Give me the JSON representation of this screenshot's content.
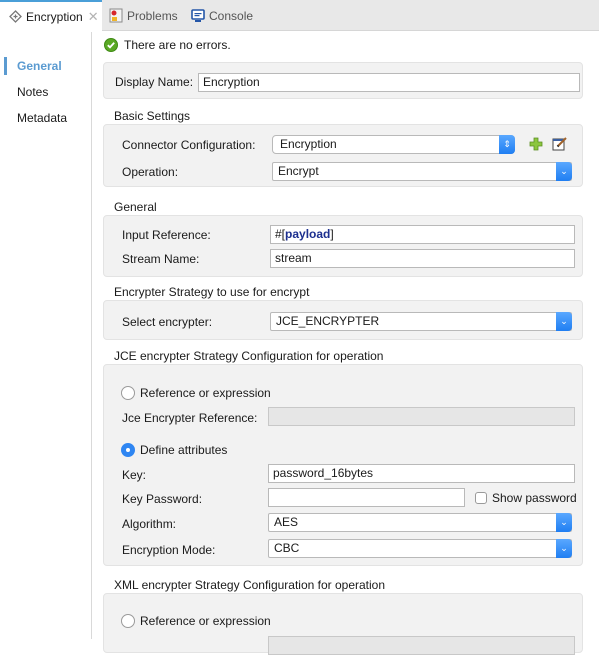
{
  "tabs": [
    {
      "label": "Encryption",
      "icon": "connector-icon",
      "active": true,
      "closable": true
    },
    {
      "label": "Problems",
      "icon": "problems-icon",
      "active": false
    },
    {
      "label": "Console",
      "icon": "console-icon",
      "active": false
    }
  ],
  "sidebar": {
    "items": [
      {
        "label": "General",
        "active": true
      },
      {
        "label": "Notes",
        "active": false
      },
      {
        "label": "Metadata",
        "active": false
      }
    ]
  },
  "status": {
    "text": "There are no errors.",
    "icon": "check-circle-icon"
  },
  "display_name": {
    "label": "Display Name:",
    "value": "Encryption"
  },
  "basic_settings": {
    "title": "Basic Settings",
    "connector_config": {
      "label": "Connector Configuration:",
      "value": "Encryption"
    },
    "operation": {
      "label": "Operation:",
      "value": "Encrypt"
    }
  },
  "general": {
    "title": "General",
    "input_reference": {
      "label": "Input Reference:",
      "prefix": "#[",
      "expr": "payload",
      "suffix": "]"
    },
    "stream_name": {
      "label": "Stream Name:",
      "value": "stream"
    }
  },
  "encrypter_strategy": {
    "title": "Encrypter Strategy to use for encrypt",
    "select": {
      "label": "Select encrypter:",
      "value": "JCE_ENCRYPTER"
    }
  },
  "jce_config": {
    "title": "JCE encrypter Strategy Configuration for operation",
    "ref_radio": {
      "label": "Reference or expression",
      "checked": false
    },
    "ref_field": {
      "label": "Jce Encrypter Reference:",
      "value": ""
    },
    "define_radio": {
      "label": "Define attributes",
      "checked": true
    },
    "key": {
      "label": "Key:",
      "value": "password_16bytes"
    },
    "key_password": {
      "label": "Key Password:",
      "value": ""
    },
    "show_password": {
      "label": "Show password",
      "checked": false
    },
    "algorithm": {
      "label": "Algorithm:",
      "value": "AES"
    },
    "mode": {
      "label": "Encryption Mode:",
      "value": "CBC"
    }
  },
  "xml_config": {
    "title": "XML encrypter Strategy Configuration for operation",
    "ref_radio": {
      "label": "Reference or expression",
      "checked": false
    }
  }
}
